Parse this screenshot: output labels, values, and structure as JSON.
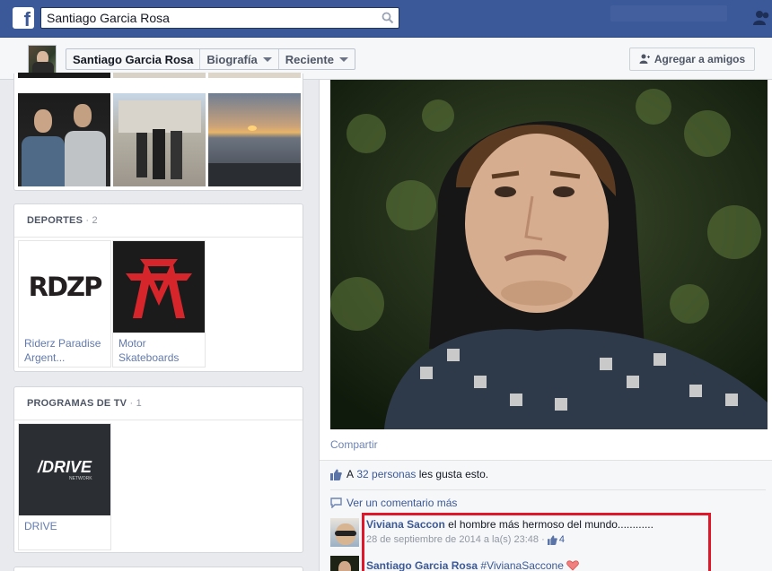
{
  "topbar": {
    "logo": "f",
    "search": {
      "value": "Santiago Garcia Rosa",
      "placeholder": ""
    }
  },
  "profile_nav": {
    "name": "Santiago Garcia Rosa",
    "biography": "Biografía",
    "recent": "Reciente",
    "add_friend": "Agregar a amigos"
  },
  "sports": {
    "title": "DEPORTES",
    "count": "· 2",
    "items": [
      {
        "label": "Riderz Paradise Argent...",
        "logo_text": "RDZP"
      },
      {
        "label": "Motor Skateboards",
        "logo_text": ""
      }
    ]
  },
  "tv": {
    "title": "PROGRAMAS DE TV",
    "count": "· 1",
    "items": [
      {
        "label": "DRIVE",
        "logo_text": "/DRIVE",
        "logo_sub": "NETWORK"
      }
    ]
  },
  "post": {
    "share": "Compartir",
    "likes_prefix": "A",
    "likes_link": "32 personas",
    "likes_suffix": "les gusta esto.",
    "more_comments": "Ver un comentario más",
    "comments": [
      {
        "author": "Viviana Saccon",
        "text": "el hombre más hermoso del mundo............",
        "date": "28 de septiembre de 2014 a la(s) 23:48",
        "separator": "·",
        "likes": "4"
      },
      {
        "author": "Santiago Garcia Rosa",
        "text": "#VivianaSaccone"
      }
    ]
  },
  "colors": {
    "brand": "#3b5998",
    "link": "#3b5998",
    "highlight": "#e0162b"
  },
  "icons": [
    "facebook-logo-icon",
    "search-icon",
    "friends-icon",
    "caret-down-icon",
    "add-friend-icon",
    "like-thumb-icon",
    "comment-bubble-icon",
    "heart-icon"
  ]
}
